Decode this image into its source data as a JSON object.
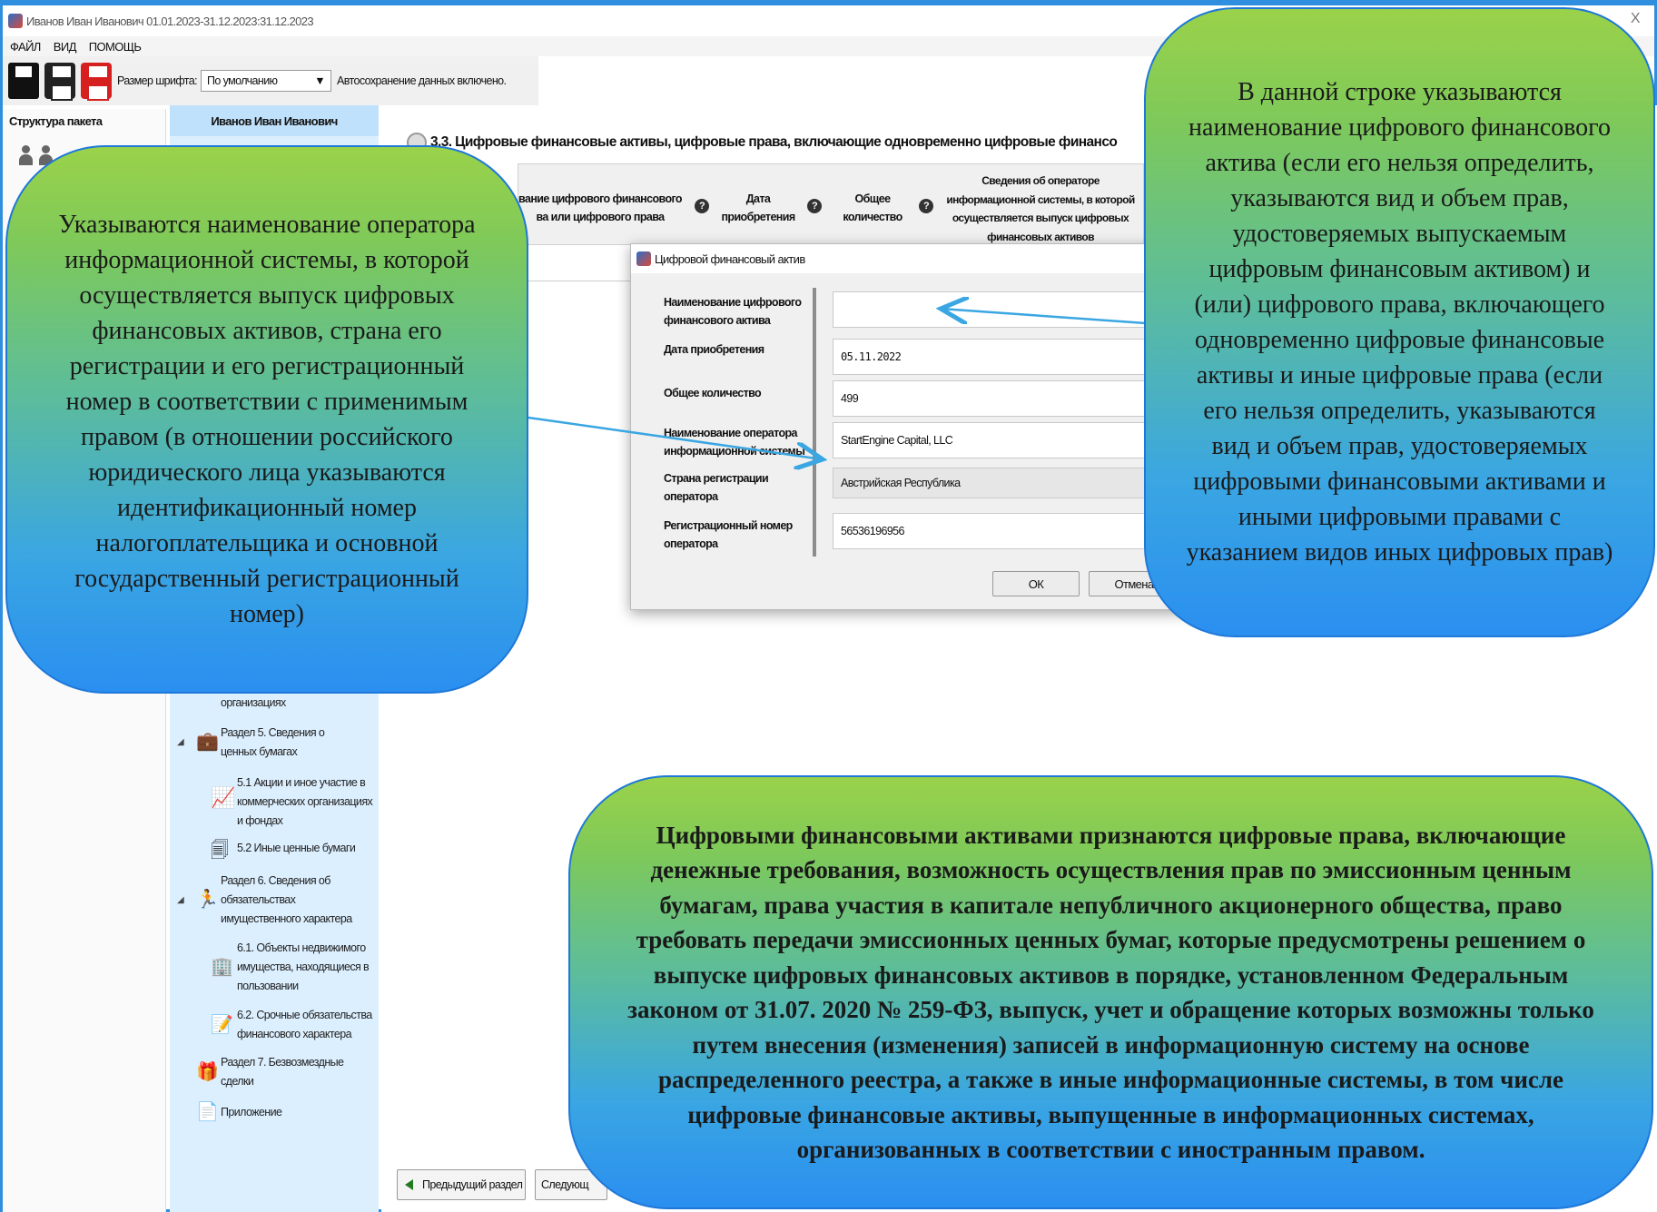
{
  "window": {
    "title": "Иванов Иван Иванович 01.01.2023-31.12.2023:31.12.2023",
    "close": "X",
    "border_color": "#2f8fde"
  },
  "menu": {
    "file": "ФАЙЛ",
    "view": "ВИД",
    "help": "ПОМОЩЬ"
  },
  "toolbar": {
    "font_size_label": "Размер шрифта:",
    "font_size_value": "По умолчанию",
    "autosave": "Автосохранение данных включено.",
    "icons": [
      "save-icon",
      "print-icon",
      "print-red-icon"
    ]
  },
  "sidebar": {
    "structure_label": "Структура пакета",
    "person_name": "Иванов Иван Иванович"
  },
  "tree": {
    "items": [
      {
        "label": "организациях",
        "icon": ""
      },
      {
        "label": "Раздел 5. Сведения о ценных бумагах",
        "icon": "briefcase-icon"
      },
      {
        "label": "5.1 Акции и иное участие в коммерческих организациях и фондах",
        "icon": "chart-icon"
      },
      {
        "label": "5.2 Иные ценные бумаги",
        "icon": "securities-icon"
      },
      {
        "label": "Раздел 6. Сведения об обязательствах имущественного характера",
        "icon": "person-running-icon"
      },
      {
        "label": "6.1. Объекты недвижимого имущества, находящиеся в пользовании",
        "icon": "building-icon"
      },
      {
        "label": "6.2. Срочные обязательства финансового характера",
        "icon": "document-icon"
      },
      {
        "label": "Раздел 7. Безвозмездные сделки",
        "icon": "gift-icon"
      },
      {
        "label": "Приложение",
        "icon": "attachment-icon"
      }
    ]
  },
  "main": {
    "section_title": "3.3. Цифровые финансовые активы, цифровые права, включающие одновременно цифровые финансо",
    "columns": [
      "вание цифрового финансового\nва или цифрового права",
      "Дата\nприобретения",
      "Общее\nколичество",
      "Сведения об операторе\nинформационной системы, в которой\nосуществляется выпуск цифровых\nфинансовых активов"
    ],
    "help_icon": "?"
  },
  "dialog": {
    "title": "Цифровой финансовый актив",
    "fields": [
      {
        "label": "Наименование цифрового\nфинансового актива",
        "value": ""
      },
      {
        "label": "Дата приобретения",
        "value": "05.11.2022"
      },
      {
        "label": "Общее количество",
        "value": "499"
      },
      {
        "label": "Наименование оператора\nинформационной системы",
        "value": "StartEngine Capital, LLC"
      },
      {
        "label": "Страна регистрации\nоператора",
        "value": "Австрийская Республика"
      },
      {
        "label": "Регистрационный номер\nоператора",
        "value": "56536196956"
      }
    ],
    "ok": "ОК",
    "cancel": "Отмена"
  },
  "nav": {
    "prev": "Предыдущий раздел",
    "next": "Следующ"
  },
  "callouts": {
    "left": "Указываются наименование оператора информационной системы, в которой осуществляется выпуск цифровых финансовых активов, страна его регистрации и его регистрационный номер в соответствии с применимым правом (в отношении российского юридического лица указываются идентификационный номер налогоплательщика и основной государственный регистрационный номер)",
    "right": "В данной строке указываются наименование цифрового финансового актива (если его нельзя определить, указываются вид и объем прав, удостоверяемых выпускаемым цифровым финансовым активом) и (или) цифрового права, включающего одновременно цифровые финансовые активы и иные цифровые права (если его нельзя определить, указываются вид и объем прав, удостоверяемых цифровыми финансовыми активами и иными цифровыми правами с указанием видов иных цифровых прав)",
    "bottom": "Цифровыми финансовыми активами признаются цифровые права, включающие денежные требования, возможность осуществления прав по эмиссионным ценным бумагам, права участия в капитале непубличного акционерного общества, право требовать передачи эмиссионных ценных бумаг, которые предусмотрены решением о выпуске цифровых финансовых активов в порядке, установленном Федеральным законом от 31.07. 2020 № 259-ФЗ, выпуск, учет и обращение которых возможны только путем внесения (изменения) записей в информационную систему на основе распределенного реестра, а также в иные информационные системы, в том числе цифровые финансовые активы, выпущенные в информационных системах, организованных в соответствии с иностранным правом.",
    "arrow_color": "#3aa6e2"
  }
}
